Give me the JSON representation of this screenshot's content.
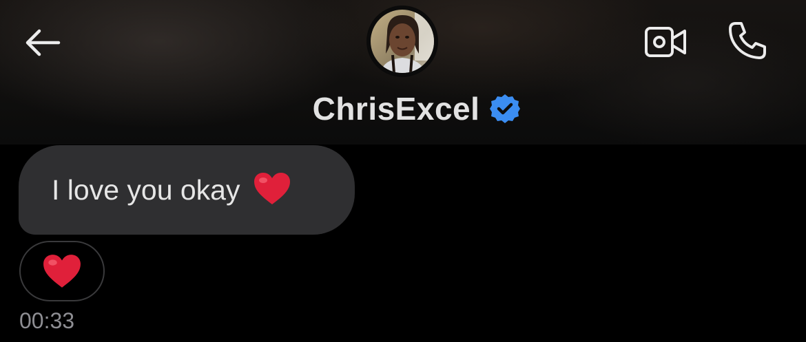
{
  "header": {
    "back_icon": "arrow-left-icon",
    "contact_name": "ChrisExcel",
    "verified_icon": "verified-badge-icon",
    "verified_color": "#3b8df2",
    "video_call_icon": "video-camera-icon",
    "voice_call_icon": "phone-icon"
  },
  "messages": [
    {
      "text": "I love you okay",
      "emoji": "red-heart-icon"
    }
  ],
  "reaction": {
    "emoji": "red-heart-icon"
  },
  "timestamp": "00:33",
  "colors": {
    "background": "#000000",
    "bubble": "#2f2f31",
    "text": "#e6e6e6",
    "timestamp": "#8e8e93",
    "heart": "#e0203a"
  }
}
